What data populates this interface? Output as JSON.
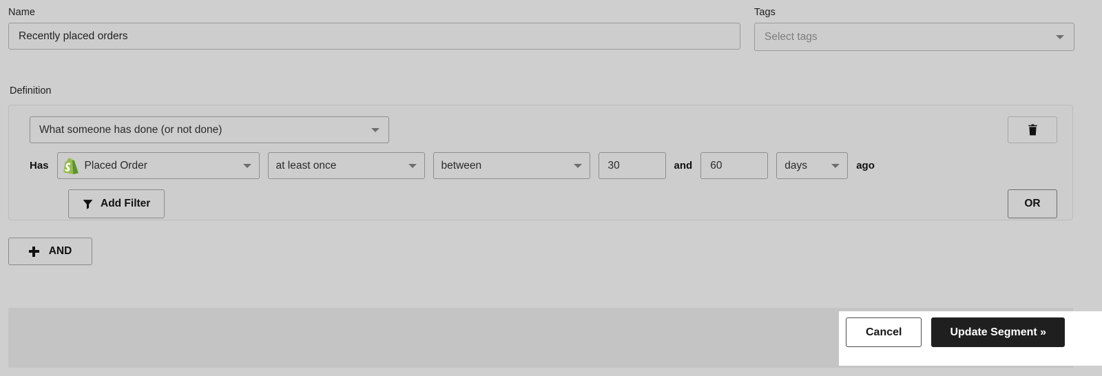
{
  "form": {
    "name": {
      "label": "Name",
      "value": "Recently placed orders"
    },
    "tags": {
      "label": "Tags",
      "placeholder": "Select tags"
    },
    "definition": {
      "label": "Definition",
      "condition_type": "What someone has done (or not done)",
      "has_label": "Has",
      "metric": "Placed Order",
      "metric_icon": "shopify-icon",
      "frequency": "at least once",
      "timeframe": "between",
      "value_from": "30",
      "joiner": "and",
      "value_to": "60",
      "unit": "days",
      "suffix": "ago",
      "add_filter_label": "Add Filter",
      "add_filter_icon": "filter-funnel-icon",
      "delete_icon": "trash-icon",
      "or_label": "OR"
    },
    "and_button": {
      "label": "AND",
      "icon": "plus-icon"
    }
  },
  "footer": {
    "cancel_label": "Cancel",
    "submit_label": "Update Segment »"
  },
  "colors": {
    "page_background": "#cfcfcf",
    "panel_background": "#cdcdcd",
    "footer_background": "#c4c4c4",
    "highlight": "#ffffff",
    "primary_button": "#1f1f1f",
    "shopify_green": "#95bf47",
    "shopify_green_dark": "#5e8e3e",
    "text": "#1f1f1f",
    "placeholder_text": "#7a7a7a"
  }
}
